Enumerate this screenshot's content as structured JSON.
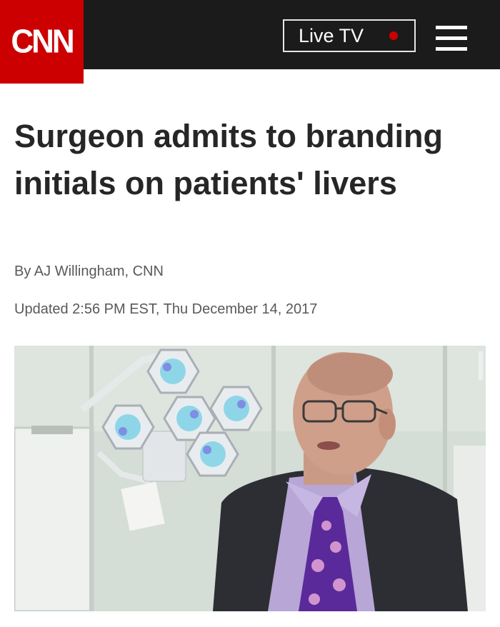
{
  "header": {
    "logo_text": "CNN",
    "live_label": "Live TV",
    "menu_icon": "hamburger-menu-icon",
    "colors": {
      "bar": "#1b1b1b",
      "brand_red": "#cc0000"
    }
  },
  "article": {
    "headline": "Surgeon admits to branding initials on patients' livers",
    "byline": "By AJ Willingham, CNN",
    "updated": "Updated 2:56 PM EST, Thu December 14, 2017"
  }
}
